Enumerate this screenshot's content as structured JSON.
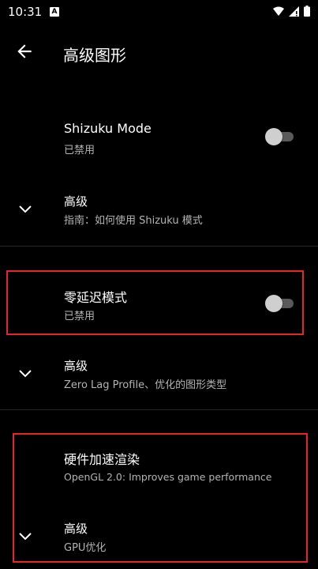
{
  "status_bar": {
    "time": "10:31",
    "app_indicator": "A",
    "icons": [
      "wifi-icon",
      "signal-icon",
      "battery-icon"
    ]
  },
  "app_bar": {
    "title": "高级图形",
    "back_icon": "arrow-left-icon"
  },
  "settings": {
    "shizuku": {
      "title": "Shizuku Mode",
      "summary": "已禁用",
      "enabled": false
    },
    "shizuku_advanced": {
      "title": "高级",
      "summary": "指南：如何使用 Shizuku 模式",
      "icon": "chevron-down-icon"
    },
    "zero_lag": {
      "title": "零延迟模式",
      "summary": "已禁用",
      "enabled": false
    },
    "zero_lag_advanced": {
      "title": "高级",
      "summary": "Zero Lag Profile、优化的图形类型",
      "icon": "chevron-down-icon"
    },
    "hw_render": {
      "title": "硬件加速渲染",
      "summary": "OpenGL 2.0: Improves game performance"
    },
    "hw_render_advanced": {
      "title": "高级",
      "summary": "GPU优化",
      "icon": "chevron-down-icon"
    }
  },
  "colors": {
    "background": "#000000",
    "highlight": "#e5242b",
    "summary_text": "#b3b3b3"
  }
}
